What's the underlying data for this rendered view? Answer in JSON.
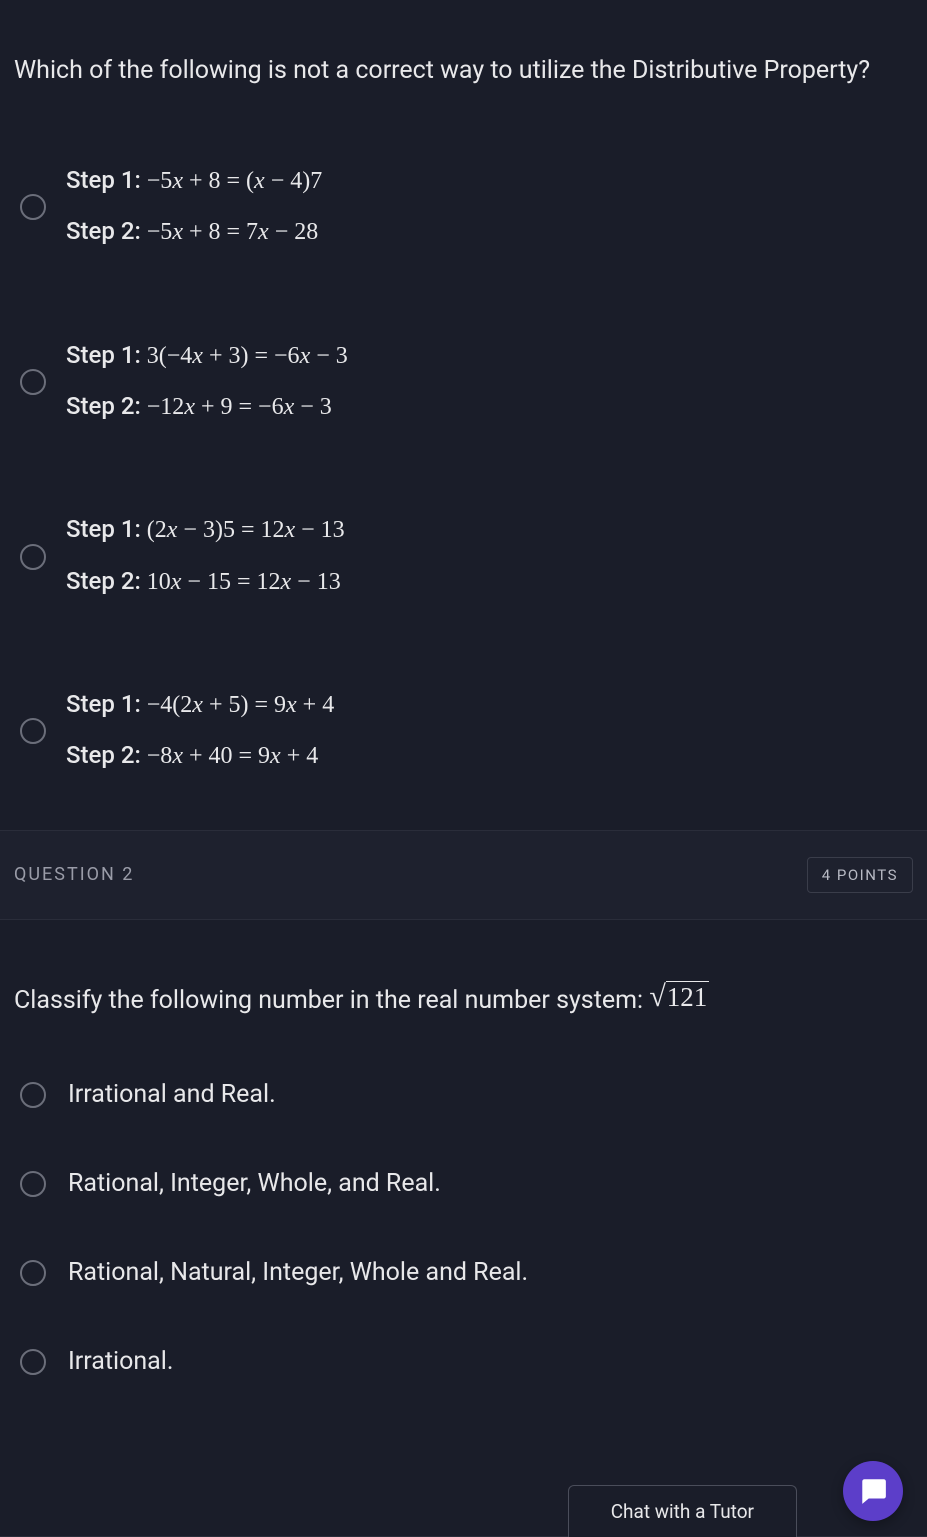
{
  "q1": {
    "prompt": "Which of the following is not a correct way to utilize the Distributive Property?",
    "options": [
      {
        "step1_label": "Step 1: ",
        "step1_math": "−5x + 8 = (x − 4)7",
        "step2_label": "Step 2: ",
        "step2_math": "−5x + 8 = 7x − 28"
      },
      {
        "step1_label": "Step 1: ",
        "step1_math": "3(−4x + 3) = −6x − 3",
        "step2_label": "Step 2: ",
        "step2_math": "−12x + 9 = −6x − 3"
      },
      {
        "step1_label": "Step 1: ",
        "step1_math": "(2x − 3)5 = 12x − 13",
        "step2_label": "Step 2: ",
        "step2_math": "10x − 15 = 12x − 13"
      },
      {
        "step1_label": "Step 1: ",
        "step1_math": "−4(2x + 5) = 9x + 4",
        "step2_label": "Step 2: ",
        "step2_math": "−8x + 40 = 9x + 4"
      }
    ]
  },
  "q2": {
    "header_title": "QUESTION 2",
    "points": "4 POINTS",
    "prompt_text": "Classify the following number in the real number system:  ",
    "prompt_radicand": "121",
    "options": [
      "Irrational and Real.",
      "Rational, Integer, Whole, and Real.",
      "Rational, Natural, Integer, Whole and Real.",
      "Irrational."
    ]
  },
  "chat": {
    "label": "Chat with a Tutor"
  }
}
